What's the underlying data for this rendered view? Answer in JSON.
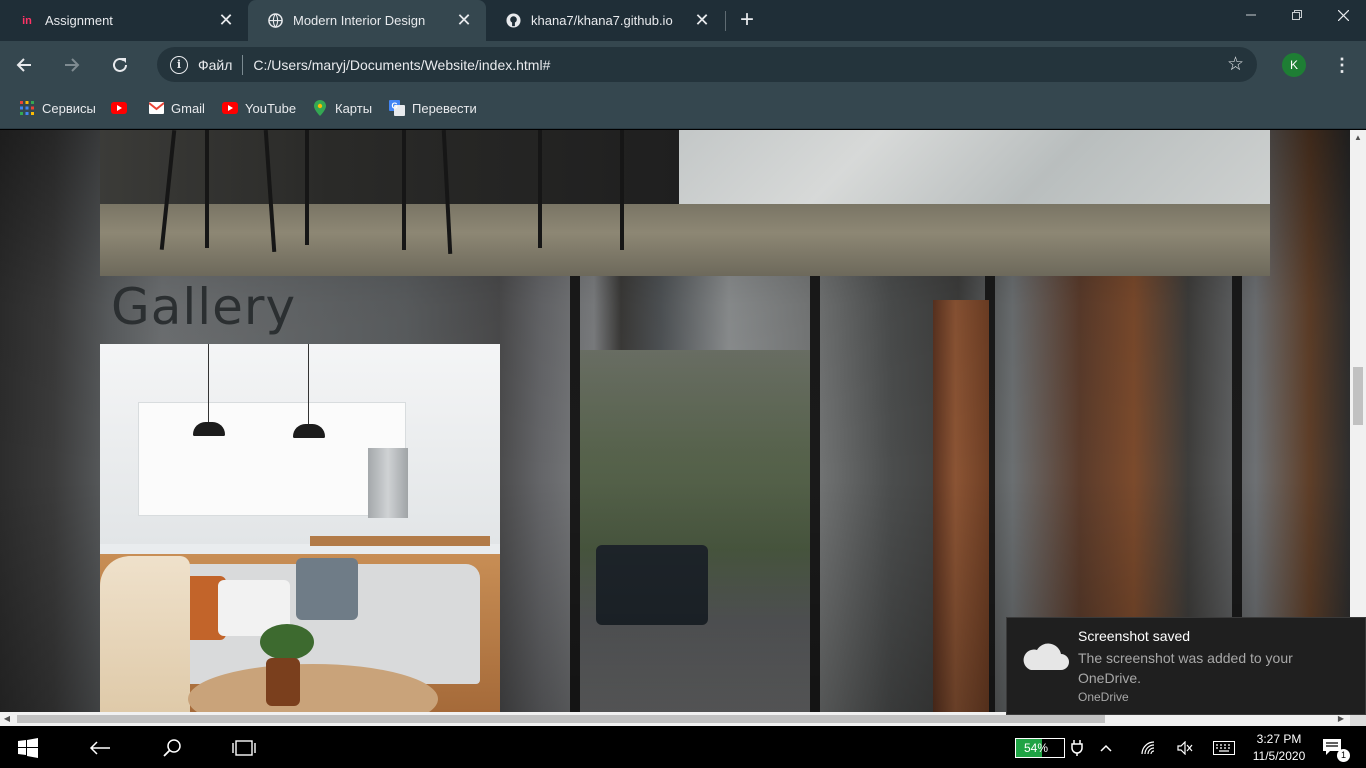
{
  "browser": {
    "tabs": [
      {
        "title": "Assignment",
        "favicon": "invision-icon",
        "active": false
      },
      {
        "title": "Modern Interior Design",
        "favicon": "globe-icon",
        "active": true
      },
      {
        "title": "khana7/khana7.github.io",
        "favicon": "github-icon",
        "active": false
      }
    ],
    "omnibox": {
      "scheme_label": "Файл",
      "url": "C:/Users/maryj/Documents/Website/index.html#"
    },
    "profile_initial": "K",
    "profile_color": "#1e7e34",
    "bookmarks": [
      {
        "label": "Сервисы",
        "icon": "apps-grid-icon"
      },
      {
        "label": "",
        "icon": "youtube-icon"
      },
      {
        "label": "Gmail",
        "icon": "gmail-icon"
      },
      {
        "label": "YouTube",
        "icon": "youtube-icon"
      },
      {
        "label": "Карты",
        "icon": "maps-pin-icon"
      },
      {
        "label": "Перевести",
        "icon": "translate-icon"
      }
    ]
  },
  "page": {
    "gallery_title": "Gallery"
  },
  "toast": {
    "title": "Screenshot saved",
    "body": "The screenshot was added to your OneDrive.",
    "app": "OneDrive"
  },
  "taskbar": {
    "battery_percent": "54%",
    "battery_level": 0.54,
    "time": "3:27 PM",
    "date": "11/5/2020",
    "notification_count": "1"
  },
  "colors": {
    "tabstrip": "#1f2e37",
    "toolbar": "#35474f",
    "battery_fill": "#1fa344"
  }
}
